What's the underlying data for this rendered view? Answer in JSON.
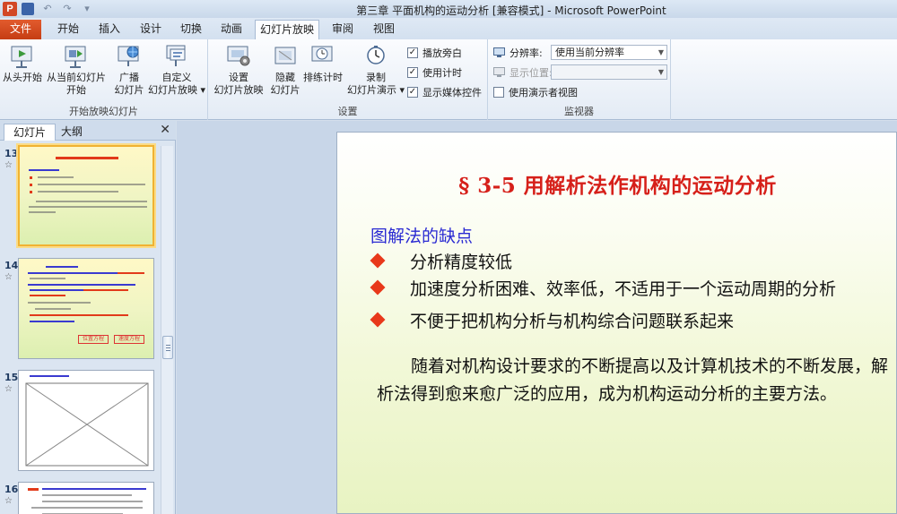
{
  "window": {
    "title": "第三章 平面机构的运动分析 [兼容模式] - Microsoft PowerPoint",
    "app_icon_letter": "P"
  },
  "tabs": [
    "文件",
    "开始",
    "插入",
    "设计",
    "切换",
    "动画",
    "幻灯片放映",
    "审阅",
    "视图"
  ],
  "ribbon": {
    "group1": {
      "label": "开始放映幻灯片",
      "buttons": [
        {
          "line1": "从头开始",
          "line2": ""
        },
        {
          "line1": "从当前幻灯片",
          "line2": "开始"
        },
        {
          "line1": "广播",
          "line2": "幻灯片"
        },
        {
          "line1": "自定义",
          "line2": "幻灯片放映 ▾"
        }
      ]
    },
    "group2": {
      "label": "设置",
      "buttons": [
        {
          "line1": "设置",
          "line2": "幻灯片放映"
        },
        {
          "line1": "隐藏",
          "line2": "幻灯片"
        },
        {
          "line1": "排练计时",
          "line2": ""
        },
        {
          "line1": "录制",
          "line2": "幻灯片演示 ▾"
        }
      ],
      "checkboxes": [
        {
          "label": "播放旁白",
          "checked": "✓"
        },
        {
          "label": "使用计时",
          "checked": "✓"
        },
        {
          "label": "显示媒体控件",
          "checked": "✓"
        }
      ]
    },
    "group3": {
      "label": "监视器",
      "resolution_label": "分辨率:",
      "resolution_value": "使用当前分辨率",
      "display_label": "显示位置:",
      "display_value": "",
      "presenter_view": "使用演示者视图"
    }
  },
  "pane": {
    "tabs": [
      "幻灯片",
      "大纲"
    ],
    "close": "✕",
    "slides": [
      {
        "num": "13",
        "mark": "☆"
      },
      {
        "num": "14",
        "mark": "☆"
      },
      {
        "num": "15",
        "mark": "☆"
      },
      {
        "num": "16",
        "mark": "☆"
      }
    ],
    "thumb14_labels": [
      "位置方程",
      "速度方程"
    ]
  },
  "slide": {
    "title": "§ 3-5  用解析法作机构的运动分析",
    "subtitle": "图解法的缺点",
    "bullets": [
      "分析精度较低",
      "加速度分析困难、效率低，不适用于一个运动周期的分析",
      "不便于把机构分析与机构综合问题联系起来"
    ],
    "paragraph": "随着对机构设计要求的不断提高以及计算机技术的不断发展，解析法得到愈来愈广泛的应用，成为机构运动分析的主要方法。"
  },
  "colors": {
    "accent_file_tab": "#c53d13",
    "title_red": "#d6201a",
    "subtitle_blue": "#2a2ad2",
    "bullet_red": "#e8381a"
  }
}
